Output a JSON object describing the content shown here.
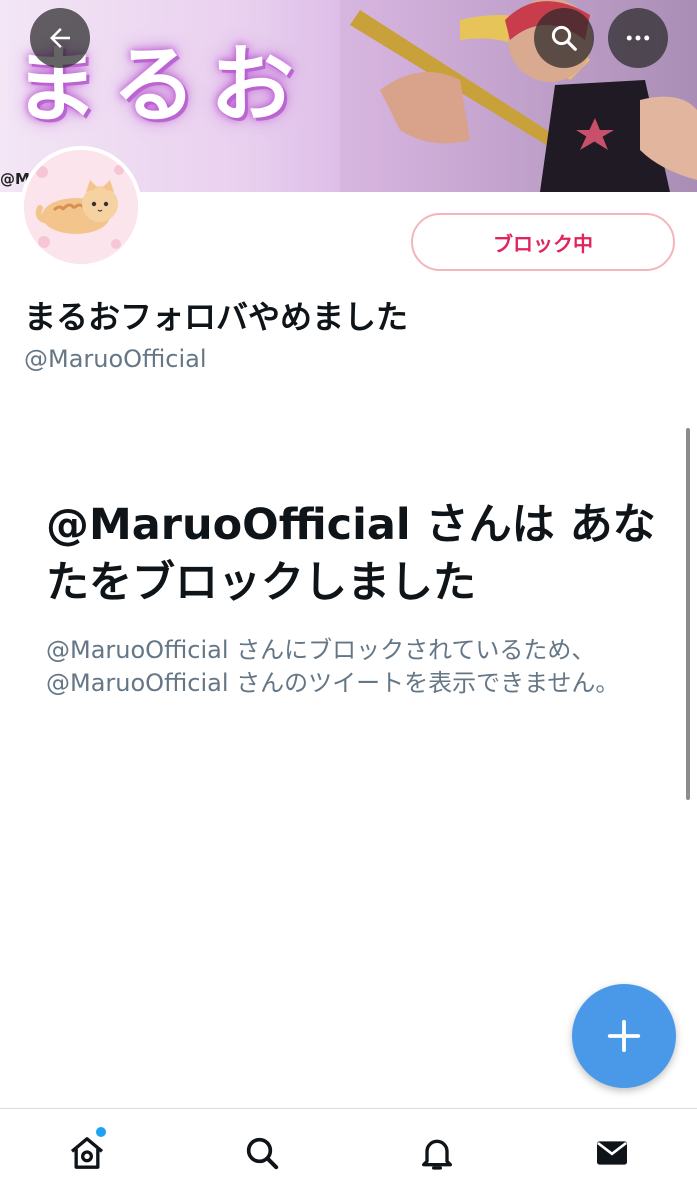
{
  "banner": {
    "title": "まるお",
    "handle_overlay": "@M"
  },
  "header": {
    "back_icon": "arrow-left-icon",
    "search_icon": "search-icon",
    "more_icon": "more-horizontal-icon"
  },
  "profile": {
    "blocked_button_label": "ブロック中",
    "display_name": "まるおフォロバやめました",
    "handle": "@MaruoOfficial"
  },
  "notice": {
    "title": "@MaruoOfficial さんは あなたをブロックしました",
    "description": "@MaruoOfficial さんにブロックされているため、@MaruoOfficial さんのツイートを表示できません。"
  },
  "colors": {
    "accent": "#4a99e9",
    "blocked_red": "#e0245e",
    "secondary_text": "#657786"
  },
  "tabbar": {
    "items": [
      "home-icon",
      "search-icon",
      "notifications-icon",
      "messages-icon"
    ],
    "home_has_notification": true
  },
  "fab": {
    "icon": "plus-icon"
  }
}
